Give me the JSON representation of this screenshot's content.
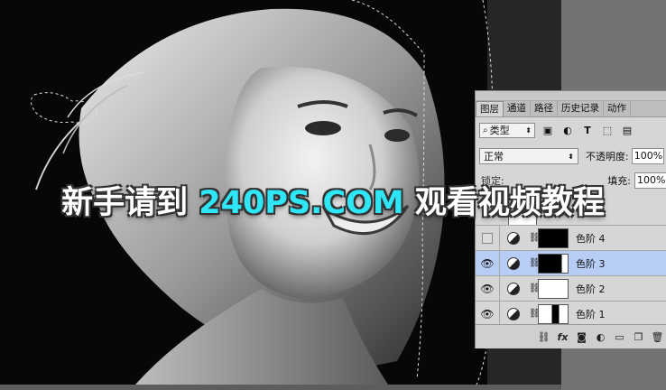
{
  "banner": {
    "prefix": "新手请到 ",
    "brand": "240PS.COM",
    "suffix": " 观看视频教程"
  },
  "panel": {
    "tabs": [
      {
        "label": "图层",
        "active": true
      },
      {
        "label": "通道",
        "active": false
      },
      {
        "label": "路径",
        "active": false
      },
      {
        "label": "历史记录",
        "active": false
      },
      {
        "label": "动作",
        "active": false
      }
    ],
    "filter": {
      "icon": "search-icon",
      "label": "类型"
    },
    "filter_icons": [
      "image-filter-icon",
      "adjustment-filter-icon",
      "type-filter-icon",
      "shape-filter-icon",
      "smart-object-filter-icon"
    ],
    "blend_mode": "正常",
    "opacity_label": "不透明度:",
    "opacity_value": "100%",
    "lock_label": "锁定:",
    "fill_label": "填充:",
    "fill_value": "100%",
    "layers": [
      {
        "name": "色阶 4",
        "visible": false,
        "selected": false,
        "mask": "black"
      },
      {
        "name": "色阶 3",
        "visible": true,
        "selected": true,
        "mask": "mostly-black"
      },
      {
        "name": "色阶 2",
        "visible": true,
        "selected": false,
        "mask": "white"
      },
      {
        "name": "色阶 1",
        "visible": true,
        "selected": false,
        "mask": "white-with-black"
      }
    ],
    "footer_buttons": [
      "link-icon",
      "fx-icon",
      "mask-icon",
      "adjustment-icon",
      "folder-icon",
      "new-layer-icon",
      "trash-icon"
    ]
  },
  "colors": {
    "brand": "#2ee6f5",
    "selected_row": "#b7cdf5"
  }
}
